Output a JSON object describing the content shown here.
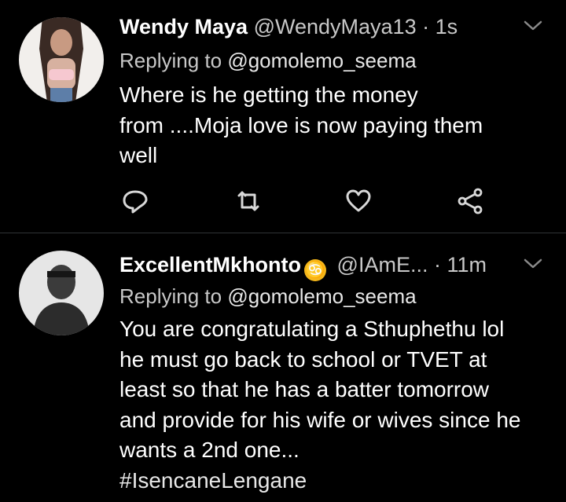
{
  "tweets": [
    {
      "name": "Wendy Maya",
      "handle": "@WendyMaya13",
      "dot": "·",
      "time": "1s",
      "replying_prefix": "Replying to",
      "replying_to": "@gomolemo_seema",
      "lines": [
        "Where is he getting the money",
        "from ....Moja love is now paying them",
        "well"
      ],
      "icons": [
        "reply-icon",
        "retweet-icon",
        "like-icon",
        "share-icon",
        "chevron-down-icon"
      ]
    },
    {
      "name": "ExcellentMkhonto",
      "emoji": "♋",
      "handle": "@IAmE...",
      "dot": "·",
      "time": "11m",
      "replying_prefix": "Replying to",
      "replying_to": "@gomolemo_seema",
      "lines": [
        "You are congratulating a Sthuphethu lol",
        "he must go back to school or TVET at",
        "least so that he has a batter tomorrow",
        "and provide for his wife or wives since he",
        "wants a 2nd one..."
      ],
      "hashtag": "#IsencaneLengane",
      "icons": [
        "chevron-down-icon"
      ]
    }
  ],
  "colors": {
    "background": "#000000",
    "secondary_text": "#c8c8c8",
    "divider": "#2f3336",
    "emoji": "#f4b61a"
  }
}
